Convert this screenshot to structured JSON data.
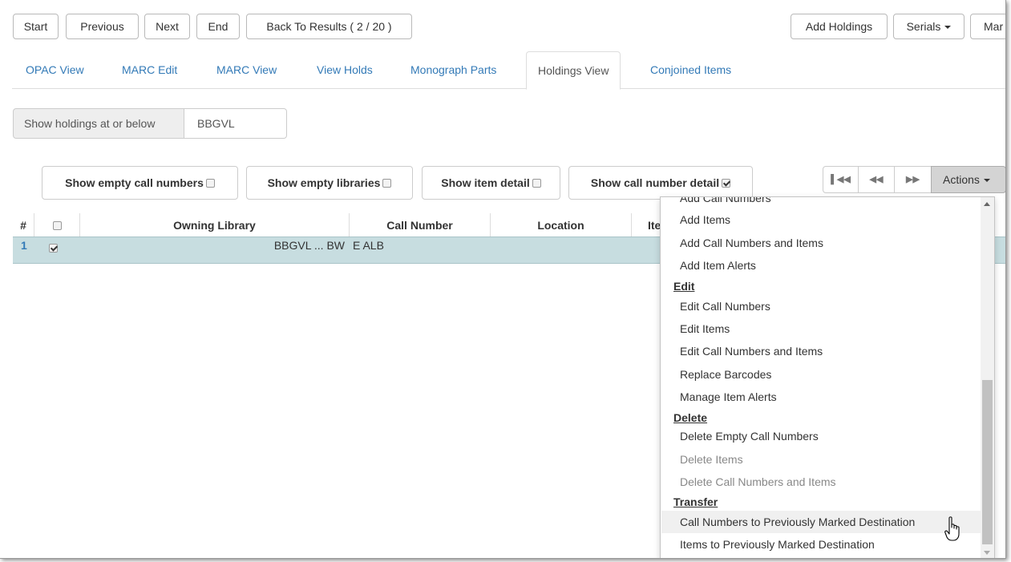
{
  "toolbar": {
    "start": "Start",
    "previous": "Previous",
    "next": "Next",
    "end": "End",
    "back_to_results": "Back To Results ( 2 / 20 )",
    "add_holdings": "Add Holdings",
    "serials": "Serials",
    "mark_partial": "Mar"
  },
  "tabs": {
    "opac_view": "OPAC View",
    "marc_edit": "MARC Edit",
    "marc_view": "MARC View",
    "view_holds": "View Holds",
    "monograph_parts": "Monograph Parts",
    "holdings_view": "Holdings View",
    "conjoined_items": "Conjoined Items"
  },
  "holdings_filter": {
    "label": "Show holdings at or below",
    "value": "BBGVL"
  },
  "toggles": {
    "empty_call_numbers": {
      "label": "Show empty call numbers",
      "checked": false
    },
    "empty_libraries": {
      "label": "Show empty libraries",
      "checked": false
    },
    "item_detail": {
      "label": "Show item detail",
      "checked": false
    },
    "call_number_detail": {
      "label": "Show call number detail",
      "checked": true
    }
  },
  "pager": {
    "first_icon": "first-page-icon",
    "prev_icon": "prev-page-icon",
    "next_icon": "next-page-icon"
  },
  "actions": {
    "label": "Actions"
  },
  "grid": {
    "headers": {
      "index": "#",
      "owning_library": "Owning Library",
      "call_number": "Call Number",
      "location": "Location",
      "item_partial": "Ite"
    },
    "rows": [
      {
        "index": "1",
        "selected": true,
        "owning_library": "BBGVL ... BW",
        "call_number": "E ALB"
      }
    ]
  },
  "menu": {
    "cut_top": "Add Call Numbers",
    "add_items": "Add Items",
    "add_call_numbers_and_items": "Add Call Numbers and Items",
    "add_item_alerts": "Add Item Alerts",
    "edit_header": "Edit",
    "edit_call_numbers": "Edit Call Numbers",
    "edit_items": "Edit Items",
    "edit_call_numbers_and_items": "Edit Call Numbers and Items",
    "replace_barcodes": "Replace Barcodes",
    "manage_item_alerts": "Manage Item Alerts",
    "delete_header": "Delete",
    "delete_empty_call_numbers": "Delete Empty Call Numbers",
    "delete_items": "Delete Items",
    "delete_call_numbers_and_items": "Delete Call Numbers and Items",
    "transfer_header": "Transfer",
    "call_numbers_to_marked": "Call Numbers to Previously Marked Destination",
    "items_to_marked": "Items to Previously Marked Destination"
  },
  "colors": {
    "link": "#337ab7",
    "row_selected": "#c7dde0",
    "actions_active": "#d4d4d4"
  }
}
